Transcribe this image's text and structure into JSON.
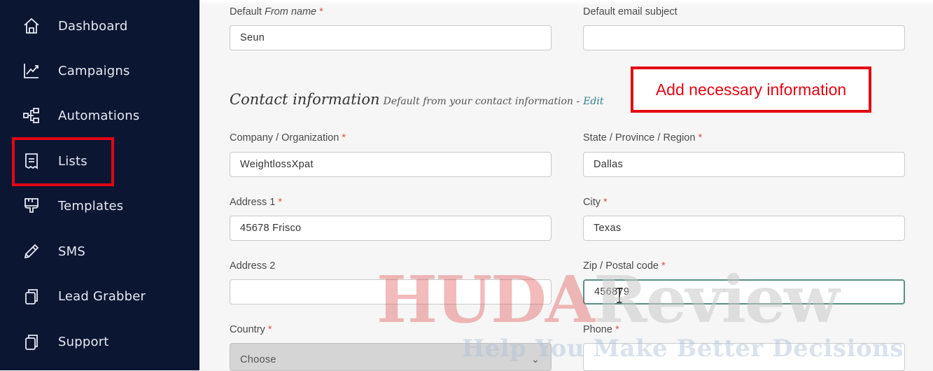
{
  "sidebar": {
    "items": [
      {
        "label": "Dashboard",
        "icon": "home-icon"
      },
      {
        "label": "Campaigns",
        "icon": "chart-line-icon"
      },
      {
        "label": "Automations",
        "icon": "workflow-icon"
      },
      {
        "label": "Lists",
        "icon": "list-document-icon"
      },
      {
        "label": "Templates",
        "icon": "brush-icon"
      },
      {
        "label": "SMS",
        "icon": "pencil-icon"
      },
      {
        "label": "Lead Grabber",
        "icon": "copy-icon"
      },
      {
        "label": "Support",
        "icon": "copy-icon"
      }
    ],
    "highlight_color": "#e30613"
  },
  "form": {
    "from_name": {
      "label_prefix": "Default ",
      "label_italic": "From name",
      "required": "*",
      "value": "Seun"
    },
    "email_subject": {
      "label": "Default email subject",
      "value": ""
    },
    "contact_section": {
      "title": "Contact information",
      "subtitle": "Default from your contact information -",
      "edit_link": "Edit"
    },
    "company": {
      "label": "Company / Organization",
      "required": "*",
      "value": "WeightlossXpat"
    },
    "state": {
      "label": "State / Province / Region",
      "required": "*",
      "value": "Dallas"
    },
    "address1": {
      "label": "Address 1",
      "required": "*",
      "value": "45678 Frisco"
    },
    "city": {
      "label": "City",
      "required": "*",
      "value": "Texas"
    },
    "address2": {
      "label": "Address 2",
      "value": ""
    },
    "zip": {
      "label": "Zip / Postal code",
      "required": "*",
      "value": "456879"
    },
    "country": {
      "label": "Country",
      "required": "*",
      "value": "Choose"
    },
    "phone": {
      "label": "Phone",
      "required": "*",
      "value": ""
    }
  },
  "callout": {
    "text": "Add necessary information",
    "color": "#e30613"
  },
  "watermark": {
    "part1": "HUDA",
    "part2": "Review",
    "tagline": "Help You Make Better Decisions"
  },
  "colors": {
    "sidebar_bg": "#0b1633",
    "required": "#d9534f",
    "link": "#2f7d8e",
    "focus_border": "#5a8f86"
  }
}
